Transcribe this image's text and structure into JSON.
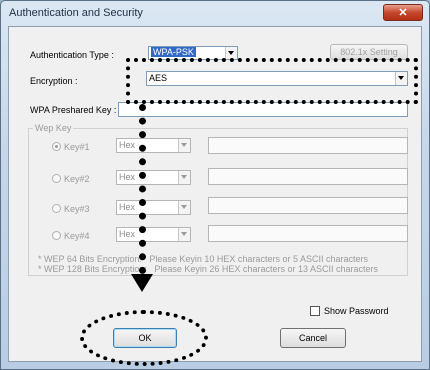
{
  "window": {
    "title": "Authentication and Security",
    "close_glyph": "✕"
  },
  "auth": {
    "type_label": "Authentication Type :",
    "type_value": "WPA-PSK",
    "setting_button": "802.1x Setting"
  },
  "encryption": {
    "label": "Encryption :",
    "value": "AES"
  },
  "preshared": {
    "label": "WPA Preshared Key :",
    "value": ""
  },
  "wep": {
    "group_label": "Wep Key",
    "keys": [
      {
        "label": "Key#1",
        "format": "Hex",
        "selected": true
      },
      {
        "label": "Key#2",
        "format": "Hex",
        "selected": false
      },
      {
        "label": "Key#3",
        "format": "Hex",
        "selected": false
      },
      {
        "label": "Key#4",
        "format": "Hex",
        "selected": false
      }
    ],
    "note1": "* WEP 64 Bits Encryption:   Please Keyin 10 HEX characters or 5 ASCII characters",
    "note2": "* WEP 128 Bits Encryption:   Please Keyin 26 HEX characters or 13 ASCII characters"
  },
  "show_password": {
    "label": "Show Password",
    "checked": false
  },
  "buttons": {
    "ok": "OK",
    "cancel": "Cancel"
  }
}
